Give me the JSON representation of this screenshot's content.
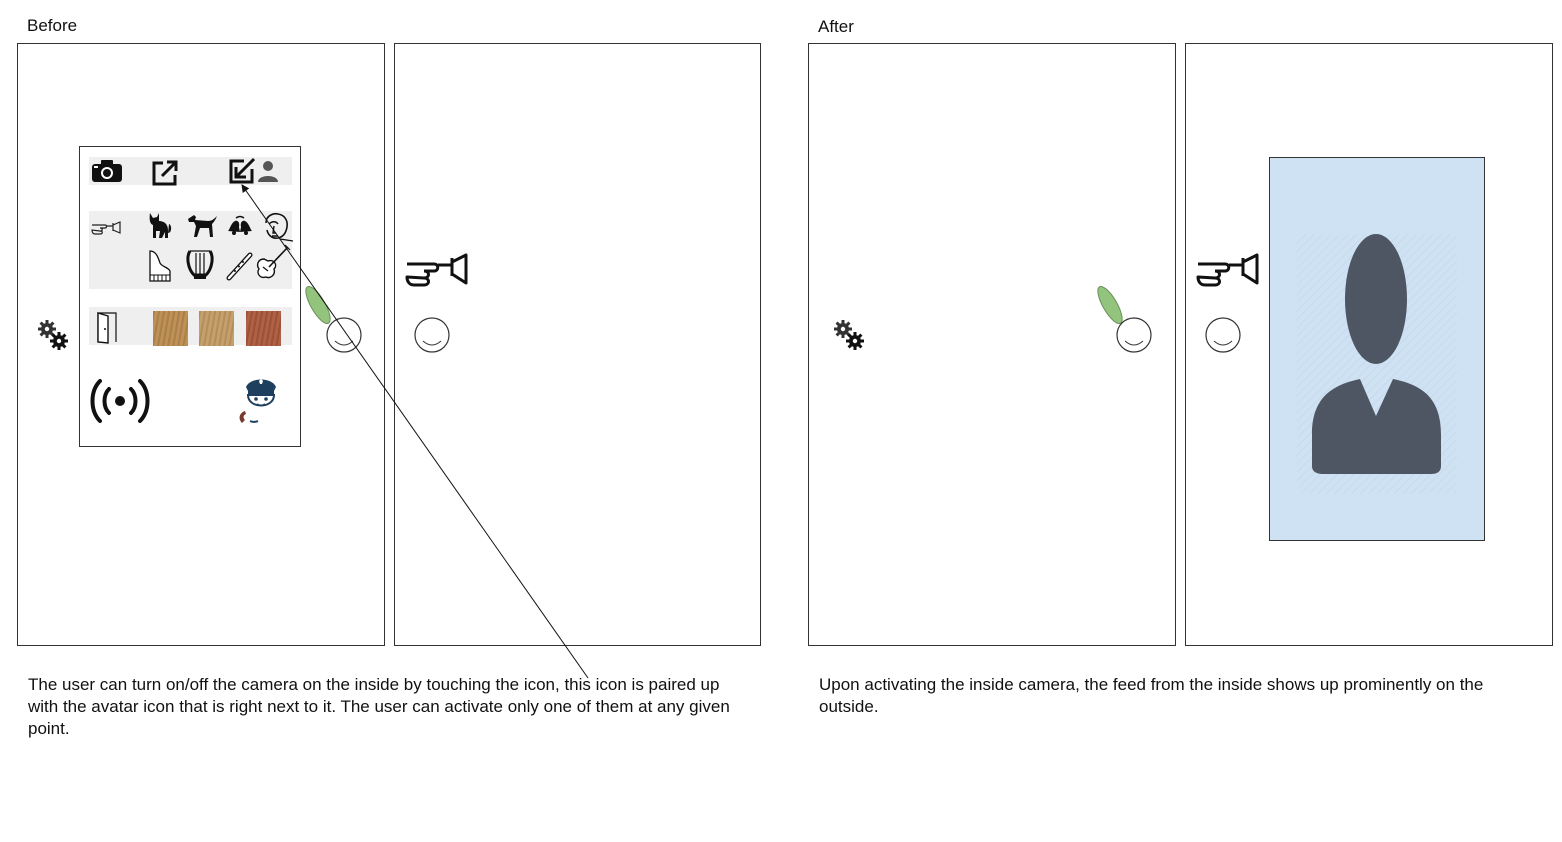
{
  "before": {
    "title": "Before",
    "caption": "The user can turn on/off the camera on the inside by touching the icon, this icon is paired up with the avatar icon that is right next to it. The user can activate only one of them at any given point.",
    "menu_icons": {
      "row1": [
        "camera-icon",
        "external-link-icon",
        "inside-camera-toggle-icon",
        "avatar-icon"
      ],
      "row2": [
        "doorbell-hand-icon",
        "cat-icon",
        "dog-icon",
        "bells-icon",
        "face-icon"
      ],
      "row3": [
        "piano-icon",
        "lyre-icon",
        "flute-icon",
        "violin-icon"
      ],
      "row4": [
        "door-icon",
        "wood-texture-light",
        "wood-texture-medium",
        "wood-texture-red"
      ],
      "row5": [
        "broadcast-icon",
        "police-call-icon"
      ]
    },
    "texture_colors": [
      "#b98a4e",
      "#c29a63",
      "#a9573a"
    ]
  },
  "after": {
    "title": "After",
    "caption": "Upon activating the inside camera, the feed from the inside shows up prominently on the outside."
  },
  "colors": {
    "feed_background": "#cfe2f3",
    "silhouette": "#4f5663",
    "leaf": "#93c47d",
    "police_navy": "#1f3f5f"
  }
}
